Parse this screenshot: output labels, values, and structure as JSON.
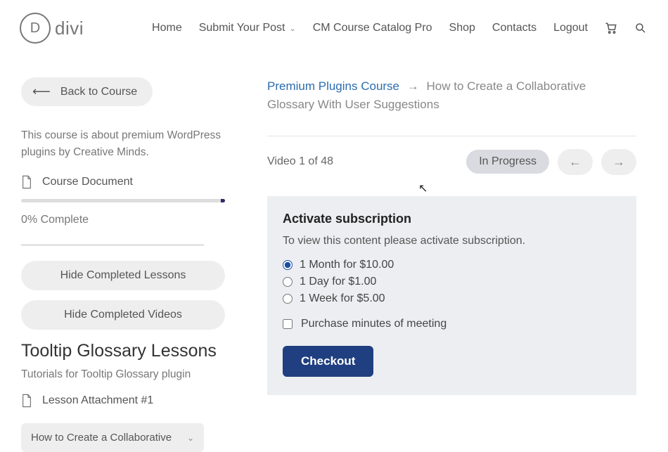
{
  "nav": {
    "logo_letter": "D",
    "logo_text": "divi",
    "items": {
      "home": "Home",
      "submit": "Submit Your Post",
      "catalog": "CM Course Catalog Pro",
      "shop": "Shop",
      "contacts": "Contacts",
      "logout": "Logout"
    }
  },
  "sidebar": {
    "back_label": "Back to Course",
    "description": "This course is about premium WordPress plugins by Creative Minds.",
    "doc_label": "Course Document",
    "progress_label": "0% Complete",
    "hide_lessons": "Hide Completed Lessons",
    "hide_videos": "Hide Completed Videos",
    "section_title": "Tooltip Glossary Lessons",
    "section_sub": "Tutorials for Tooltip Glossary plugin",
    "attachment": "Lesson Attachment #1",
    "lesson_cut": "How to Create a Collaborative"
  },
  "crumbs": {
    "root": "Premium Plugins Course",
    "here": "How to Create a Collaborative Glossary With User Suggestions"
  },
  "status": {
    "video_count": "Video 1 of 48",
    "state": "In Progress"
  },
  "panel": {
    "title": "Activate subscription",
    "prompt": "To view this content please activate subscription.",
    "options": [
      "1 Month for $10.00",
      "1 Day for $1.00",
      "1 Week for $5.00"
    ],
    "checkbox": "Purchase minutes of meeting",
    "checkout": "Checkout"
  }
}
